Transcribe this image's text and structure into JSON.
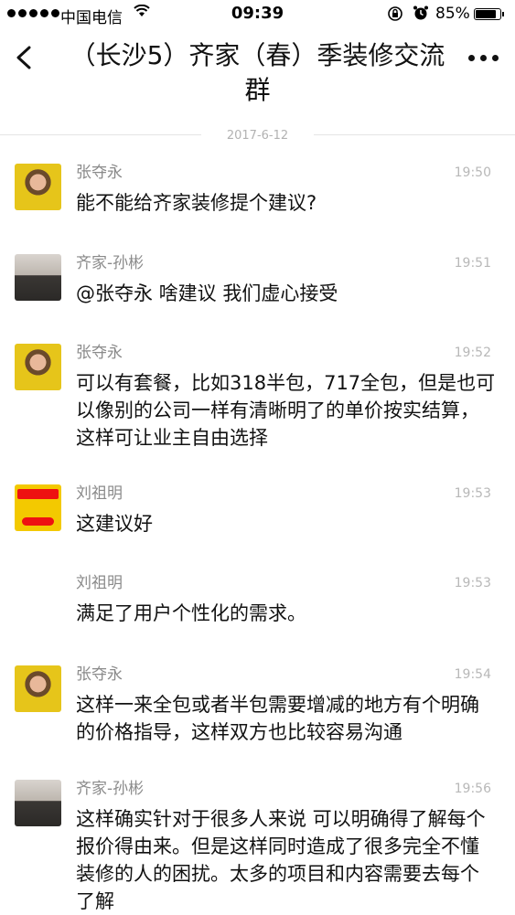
{
  "status_bar": {
    "carrier": "中国电信",
    "time": "09:39",
    "battery_percent": "85%",
    "battery_level": 0.85
  },
  "nav": {
    "title": "（长沙5）齐家（春）季装修交流群"
  },
  "date_divider": "2017-6-12",
  "messages": [
    {
      "sender": "张夺永",
      "time": "19:50",
      "text": "能不能给齐家装修提个建议?"
    },
    {
      "sender": "齐家-孙彬",
      "time": "19:51",
      "text": "@张夺永 啥建议 我们虚心接受"
    },
    {
      "sender": "张夺永",
      "time": "19:52",
      "text": "可以有套餐，比如318半包，717全包，但是也可以像别的公司一样有清晰明了的单价按实结算，这样可让业主自由选择"
    },
    {
      "sender": "刘祖明",
      "time": "19:53",
      "text": "这建议好"
    },
    {
      "sender": "刘祖明",
      "time": "19:53",
      "text": "满足了用户个性化的需求。"
    },
    {
      "sender": "张夺永",
      "time": "19:54",
      "text": "这样一来全包或者半包需要增减的地方有个明确的价格指导，这样双方也比较容易沟通"
    },
    {
      "sender": "齐家-孙彬",
      "time": "19:56",
      "text": "这样确实针对于很多人来说  可以明确得了解每个报价得由来。但是这样同时造成了很多完全不懂装修的人的困扰。太多的项目和内容需要去每个了解"
    }
  ]
}
